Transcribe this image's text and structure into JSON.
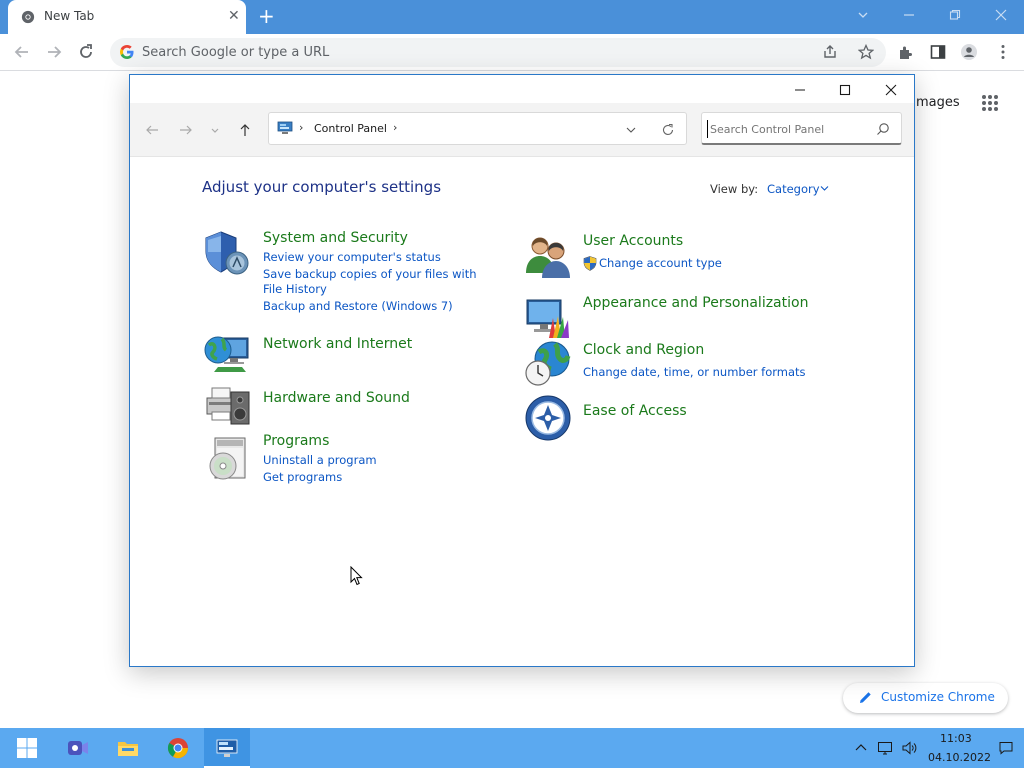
{
  "browser": {
    "tab_title": "New Tab",
    "tab_close": "✕",
    "new_tab": "+",
    "omnibox_placeholder": "Search Google or type a URL",
    "ntp_images_link": "mages",
    "customize_label": "Customize Chrome"
  },
  "window": {
    "breadcrumb": [
      "Control Panel"
    ],
    "breadcrumb_sep": "›",
    "search_placeholder": "Search Control Panel",
    "heading": "Adjust your computer's settings",
    "view_by_label": "View by:",
    "view_by_value": "Category"
  },
  "categories": [
    {
      "title": "System and Security",
      "icon": "shield-icon",
      "links": [
        "Review your computer's status",
        "Save backup copies of your files with File History",
        "Backup and Restore (Windows 7)"
      ]
    },
    {
      "title": "Network and Internet",
      "icon": "network-globe-icon",
      "links": []
    },
    {
      "title": "Hardware and Sound",
      "icon": "printer-speaker-icon",
      "links": []
    },
    {
      "title": "Programs",
      "icon": "programs-disc-icon",
      "links": [
        "Uninstall a program",
        "Get programs"
      ]
    },
    {
      "title": "User Accounts",
      "icon": "users-icon",
      "links": [
        "Change account type"
      ]
    },
    {
      "title": "Appearance and Personalization",
      "icon": "monitor-palette-icon",
      "links": []
    },
    {
      "title": "Clock and Region",
      "icon": "globe-clock-icon",
      "links": [
        "Change date, time, or number formats"
      ]
    },
    {
      "title": "Ease of Access",
      "icon": "accessibility-icon",
      "links": []
    }
  ],
  "taskbar": {
    "time": "11:03",
    "date": "04.10.2022",
    "items": [
      "start-icon",
      "meet-icon",
      "file-explorer-icon",
      "chrome-icon",
      "control-panel-icon"
    ]
  },
  "colors": {
    "tabstrip": "#4a90d9",
    "category_title": "#1b7a1b",
    "link": "#0c56c4",
    "heading": "#1e3287",
    "taskbar": "#5ba9f0"
  }
}
